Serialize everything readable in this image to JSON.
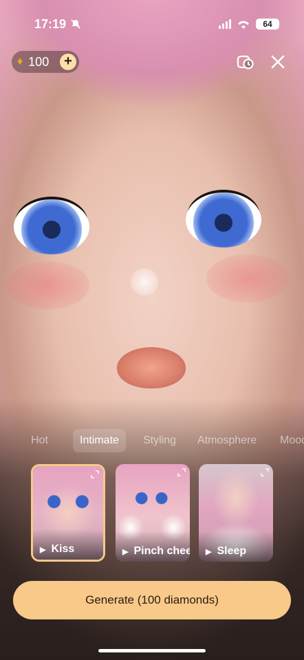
{
  "status_bar": {
    "time": "17:19",
    "battery": "64"
  },
  "header": {
    "diamond_count": "100",
    "plus_glyph": "+",
    "icons": [
      "diamond-icon",
      "plus-icon",
      "history-timer-icon",
      "close-icon"
    ]
  },
  "tabs": [
    {
      "label": "Hot",
      "active": false
    },
    {
      "label": "Intimate",
      "active": true
    },
    {
      "label": "Styling",
      "active": false
    },
    {
      "label": "Atmosphere",
      "active": false
    },
    {
      "label": "Mood",
      "active": false
    }
  ],
  "cards": [
    {
      "label": "Kiss",
      "selected": true
    },
    {
      "label": "Pinch cheek",
      "selected": false
    },
    {
      "label": "Sleep",
      "selected": false
    }
  ],
  "generate_button": {
    "label": "Generate (100 diamonds)"
  },
  "colors": {
    "accent": "#f9c98a",
    "selected_border": "#f7c98b"
  }
}
